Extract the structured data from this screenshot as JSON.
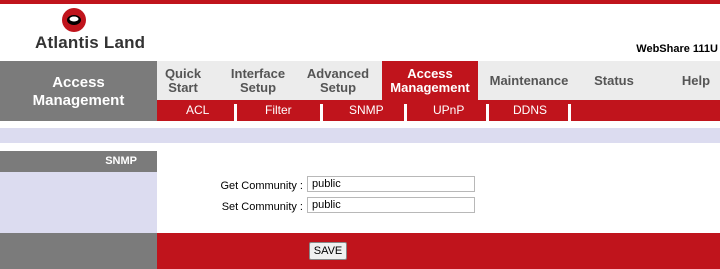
{
  "brand": {
    "logo_text": "Atlantis Land",
    "product": "WebShare 111U"
  },
  "section_title": {
    "line1": "Access",
    "line2": "Management"
  },
  "nav": [
    {
      "line1": "Quick",
      "line2": "Start"
    },
    {
      "line1": "Interface",
      "line2": "Setup"
    },
    {
      "line1": "Advanced",
      "line2": "Setup"
    },
    {
      "line1": "Access",
      "line2": "Management"
    },
    {
      "line1": "Maintenance"
    },
    {
      "line1": "Status"
    },
    {
      "line1": "Help"
    }
  ],
  "subnav": [
    "ACL",
    "Filter",
    "SNMP",
    "UPnP",
    "DDNS"
  ],
  "panel": {
    "header": "SNMP"
  },
  "form": {
    "get_label": "Get Community :",
    "get_value": "public",
    "set_label": "Set Community :",
    "set_value": "public"
  },
  "save_label": "SAVE",
  "colors": {
    "brand_red": "#c0141c",
    "gray": "#7b7b7b",
    "lavender": "#dcdcf0"
  }
}
